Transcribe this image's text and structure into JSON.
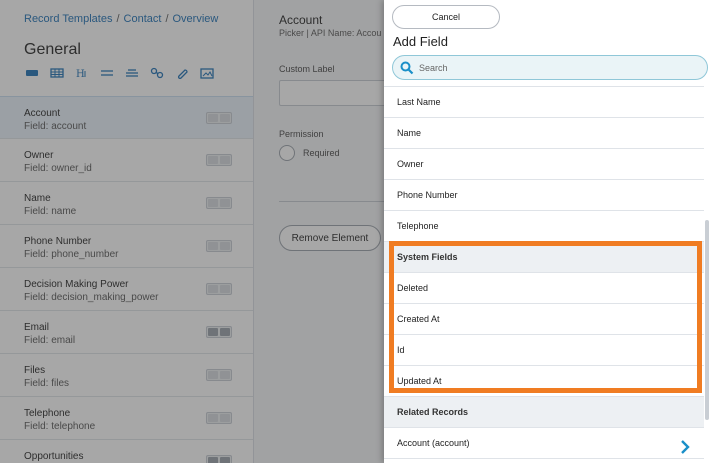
{
  "breadcrumb": [
    "Record Templates",
    "Contact",
    "Overview"
  ],
  "left_panel": {
    "title": "General",
    "toolbar_icons": [
      "card-icon",
      "table-icon",
      "heading-icon",
      "divider-icon",
      "list-icon",
      "link-icon",
      "attachment-icon",
      "image-icon"
    ],
    "fields": [
      {
        "name": "Account",
        "key": "Field: account",
        "toggle": "light",
        "active": true
      },
      {
        "name": "Owner",
        "key": "Field: owner_id",
        "toggle": "light"
      },
      {
        "name": "Name",
        "key": "Field: name",
        "toggle": "light"
      },
      {
        "name": "Phone Number",
        "key": "Field: phone_number",
        "toggle": "light"
      },
      {
        "name": "Decision Making Power",
        "key": "Field: decision_making_power",
        "toggle": "light"
      },
      {
        "name": "Email",
        "key": "Field: email",
        "toggle": "dark"
      },
      {
        "name": "Files",
        "key": "Field: files",
        "toggle": "light"
      },
      {
        "name": "Telephone",
        "key": "Field: telephone",
        "toggle": "light"
      },
      {
        "name": "Opportunities",
        "key": "",
        "toggle": "dark"
      }
    ]
  },
  "detail": {
    "title": "Account",
    "subtitle": "Picker | API Name: Accou",
    "custom_label": "Custom Label",
    "permission": "Permission",
    "required": "Required",
    "remove_button": "Remove Element"
  },
  "drawer": {
    "cancel": "Cancel",
    "title": "Add Field",
    "search_placeholder": "Search",
    "items": [
      {
        "label": "Last Name"
      },
      {
        "label": "Name"
      },
      {
        "label": "Owner"
      },
      {
        "label": "Phone Number"
      },
      {
        "label": "Telephone"
      },
      {
        "header": "System Fields"
      },
      {
        "label": "Deleted"
      },
      {
        "label": "Created At"
      },
      {
        "label": "Id"
      },
      {
        "label": "Updated At"
      },
      {
        "header": "Related Records"
      },
      {
        "label": "Account (account)",
        "chevron": true
      }
    ]
  },
  "colors": {
    "accent": "#1c6fb5",
    "highlight": "#f07c22",
    "chevron": "#1a8fc8"
  }
}
